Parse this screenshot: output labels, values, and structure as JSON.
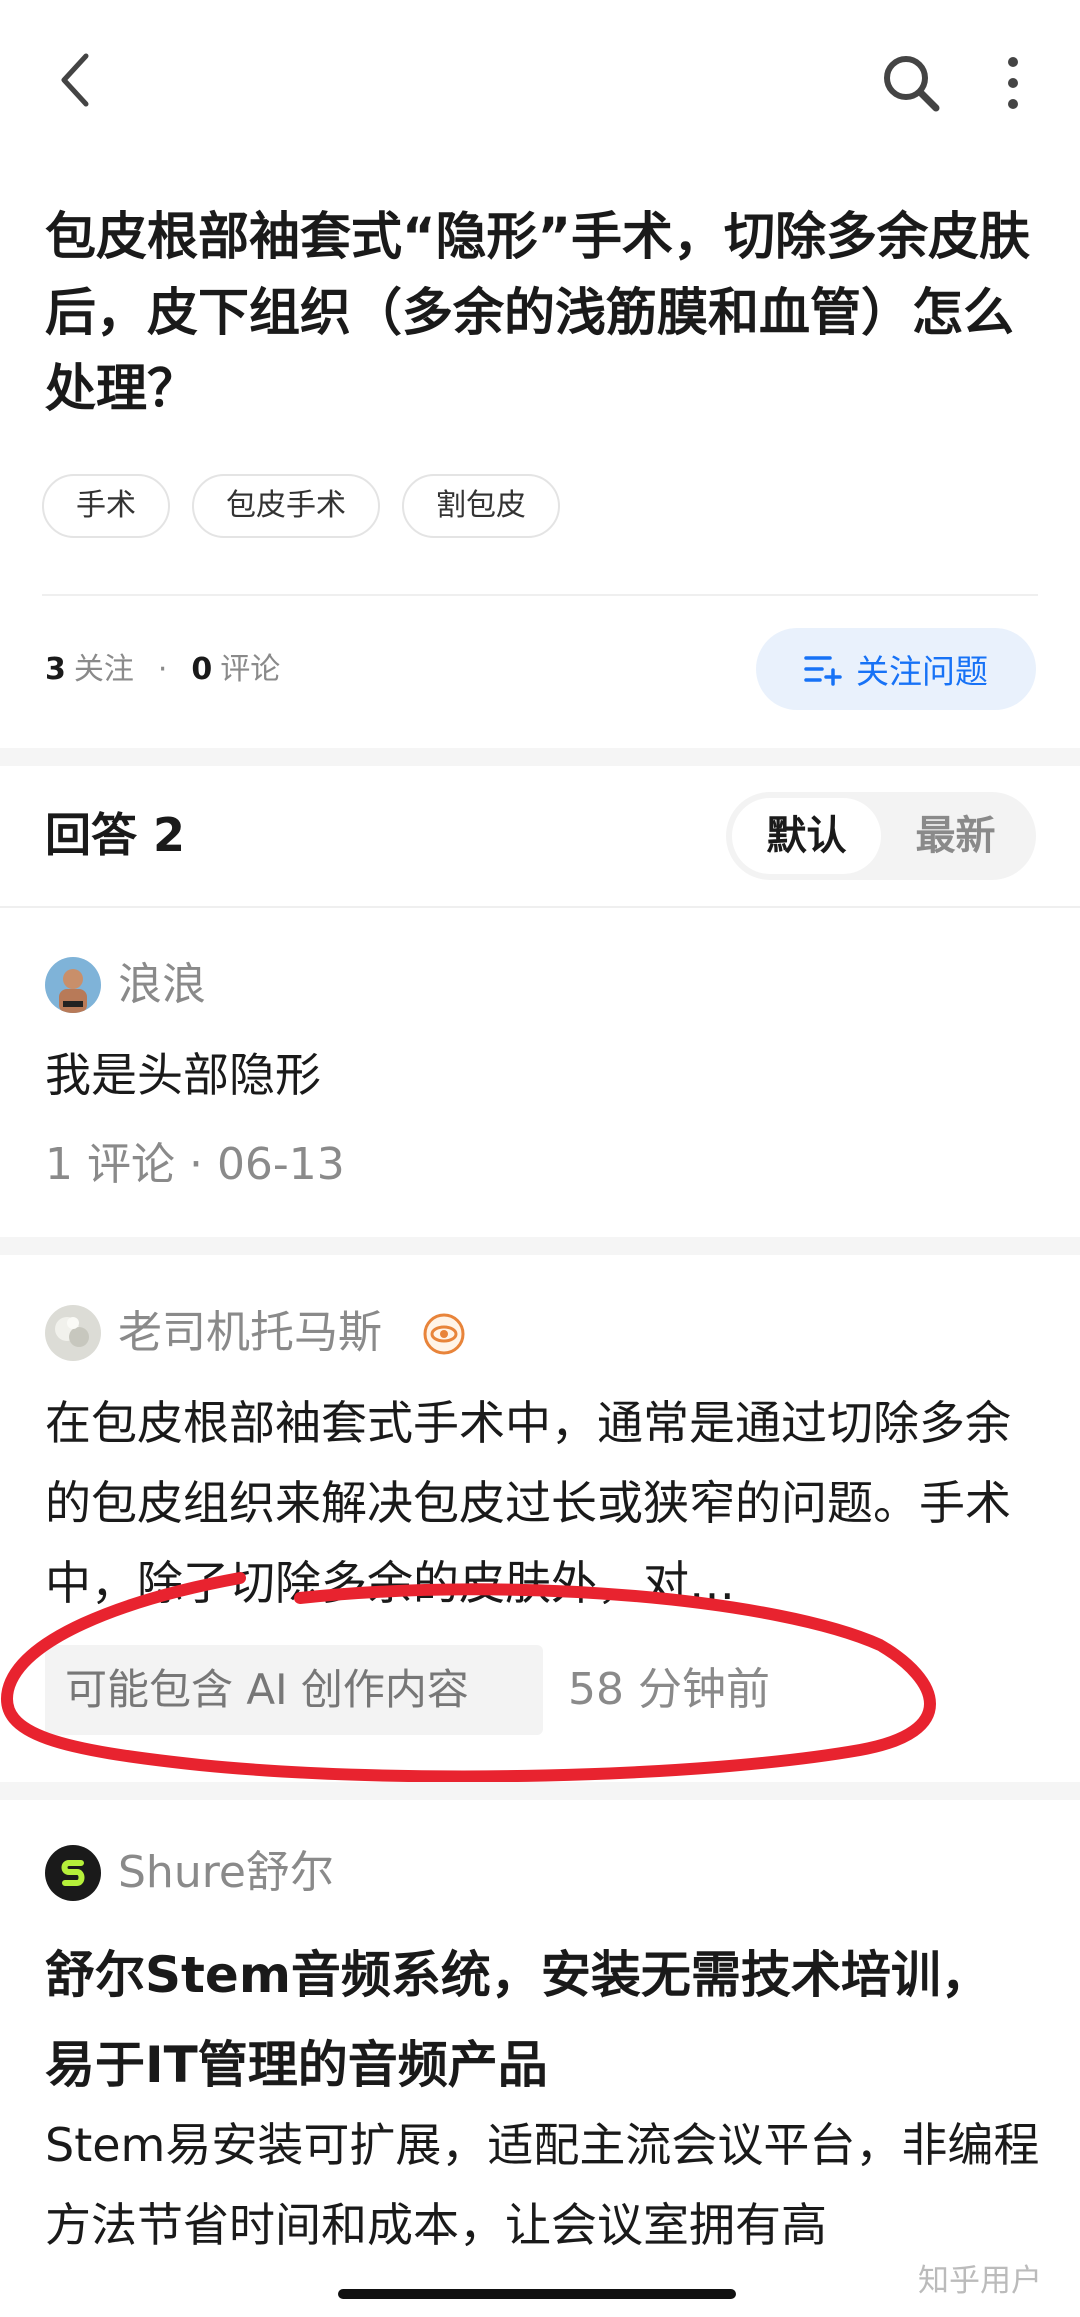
{
  "question": {
    "title": "包皮根部袖套式“隐形”手术，切除多余皮肤后，皮下组织（多余的浅筋膜和血管）怎么处理？",
    "tags": [
      "手术",
      "包皮手术",
      "割包皮"
    ],
    "follow_count": "3",
    "follow_label": "关注",
    "comment_count": "0",
    "comment_label": "评论",
    "follow_button_label": "关注问题"
  },
  "answers": {
    "header": "回答 2",
    "sort_options": [
      "默认",
      "最新"
    ],
    "selected_sort": "默认",
    "items": [
      {
        "author": "浪浪",
        "excerpt": "我是头部隐形",
        "meta": "1 评论 · 06-13"
      },
      {
        "author": "老司机托马斯",
        "excerpt": "在包皮根部袖套式手术中，通常是通过切除多余的包皮组织来解决包皮过长或狭窄的问题。手术中，除了切除多余的皮肤外，对…",
        "ai_label": "可能包含 AI 创作内容",
        "time": "58 分钟前"
      }
    ]
  },
  "ad": {
    "brand": "Shure舒尔",
    "title": "舒尔Stem音频系统，安装无需技术培训，易于IT管理的音频产品",
    "body": "Stem易安装可扩展，适配主流会议平台，非编程方法节省时间和成本，让会议室拥有高"
  },
  "watermark": "知乎用户",
  "colors": {
    "accent": "#1772f6",
    "accent_bg": "#e9f1fc",
    "annotation_red": "#e8232f"
  },
  "icons": {
    "back": "chevron-left-icon",
    "search": "search-icon",
    "more": "more-vertical-icon",
    "follow": "add-list-icon",
    "badge": "eye-badge-icon",
    "ad_logo": "shure-logo-icon"
  }
}
